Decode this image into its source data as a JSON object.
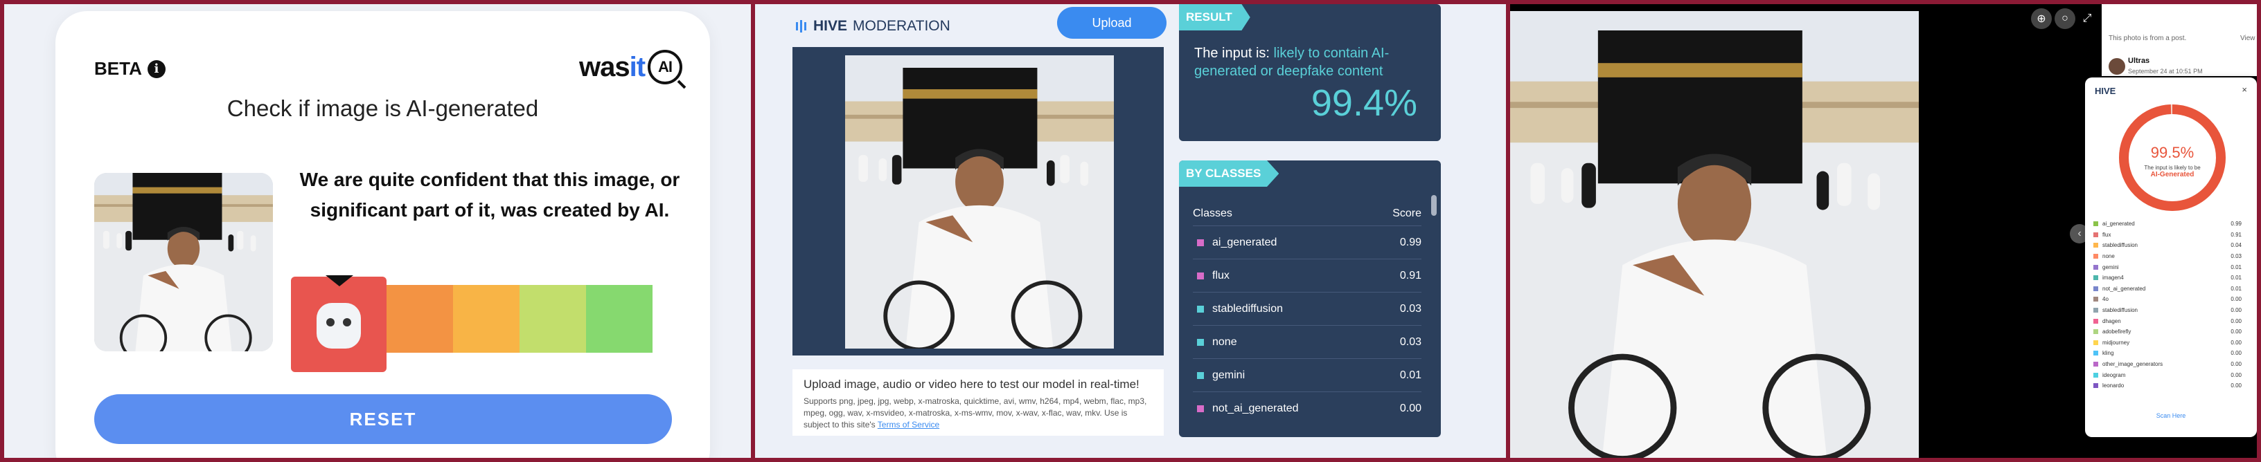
{
  "wasit": {
    "beta_label": "BETA",
    "logo_prefix": "was",
    "logo_accent": "it",
    "logo_badge": "AI",
    "title": "Check if image is AI-generated",
    "verdict": "We are quite confident that this image, or significant part of it, was created by AI.",
    "meter_colors": [
      "#e8554f",
      "#f39343",
      "#f8b446",
      "#c2de6c",
      "#86d96f"
    ],
    "meter_level": "most likely AI (leftmost segment)",
    "reset_label": "RESET"
  },
  "hive": {
    "logo_bold": "HIVE",
    "logo_light": "MODERATION",
    "upload_label": "Upload",
    "upload_heading": "Upload image, audio or video here to test our model in real-time!",
    "upload_sub": "Supports png, jpeg, jpg, webp, x-matroska, quicktime, avi, wmv, h264, mp4, webm, flac, mp3, mpeg, ogg, wav, x-msvideo, x-matroska, x-ms-wmv, mov, x-wav, x-flac, wav, mkv. Use is subject to this site's",
    "tos_link": "Terms of Service",
    "result_tag": "RESULT",
    "result_prefix": "The input is:",
    "result_verdict": "likely to contain AI-generated or deepfake content",
    "result_pct": "99.4%",
    "classes_tag": "BY CLASSES",
    "col_classes": "Classes",
    "col_score": "Score",
    "classes": [
      {
        "name": "ai_generated",
        "score": "0.99",
        "color": "#d86cc8"
      },
      {
        "name": "flux",
        "score": "0.91",
        "color": "#d86cc8"
      },
      {
        "name": "stablediffusion",
        "score": "0.03",
        "color": "#5ad0d8"
      },
      {
        "name": "none",
        "score": "0.03",
        "color": "#5ad0d8"
      },
      {
        "name": "gemini",
        "score": "0.01",
        "color": "#5ad0d8"
      },
      {
        "name": "not_ai_generated",
        "score": "0.00",
        "color": "#d86cc8"
      }
    ]
  },
  "facebook": {
    "note": "This photo is from a post.",
    "view_label": "View",
    "user": "Ultras",
    "date": "September 24 at 10:51 PM",
    "hive_label": "HIVE",
    "close": "×",
    "pct": "99.5%",
    "ring_value": 0.995,
    "small": "The input is likely to be",
    "verdict": "AI-Generated",
    "scan_more": "Scan Here",
    "items": [
      {
        "name": "ai_generated",
        "score": "0.99",
        "color": "#8bc34a"
      },
      {
        "name": "flux",
        "score": "0.91",
        "color": "#e57373"
      },
      {
        "name": "stablediffusion",
        "score": "0.04",
        "color": "#ffb74d"
      },
      {
        "name": "none",
        "score": "0.03",
        "color": "#ff8a65"
      },
      {
        "name": "gemini",
        "score": "0.01",
        "color": "#9575cd"
      },
      {
        "name": "imagen4",
        "score": "0.01",
        "color": "#4db6ac"
      },
      {
        "name": "not_ai_generated",
        "score": "0.01",
        "color": "#7986cb"
      },
      {
        "name": "4o",
        "score": "0.00",
        "color": "#a1887f"
      },
      {
        "name": "stablediffusion",
        "score": "0.00",
        "color": "#90a4ae"
      },
      {
        "name": "dhagen",
        "score": "0.00",
        "color": "#f06292"
      },
      {
        "name": "adobefirefly",
        "score": "0.00",
        "color": "#aed581"
      },
      {
        "name": "midjourney",
        "score": "0.00",
        "color": "#ffd54f"
      },
      {
        "name": "kling",
        "score": "0.00",
        "color": "#4fc3f7"
      },
      {
        "name": "other_image_generators",
        "score": "0.00",
        "color": "#ba68c8"
      },
      {
        "name": "ideogram",
        "score": "0.00",
        "color": "#4dd0e1"
      },
      {
        "name": "leonardo",
        "score": "0.00",
        "color": "#7e57c2"
      }
    ]
  }
}
